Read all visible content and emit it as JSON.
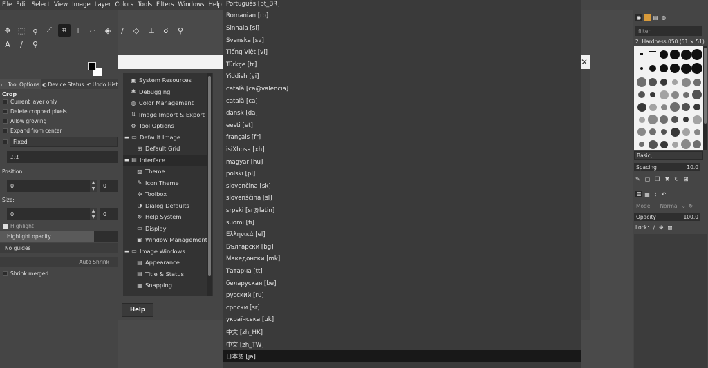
{
  "menu": [
    "File",
    "Edit",
    "Select",
    "View",
    "Image",
    "Layer",
    "Colors",
    "Tools",
    "Filters",
    "Windows",
    "Help"
  ],
  "left_tabs": {
    "tool_options": "Tool Options",
    "device_status": "Device Status",
    "undo_history": "Undo History"
  },
  "crop": {
    "title": "Crop",
    "current_layer_only": "Current layer only",
    "delete_cropped_pixels": "Delete cropped pixels",
    "allow_growing": "Allow growing",
    "expand_from_center": "Expand from center",
    "fixed_label": "Fixed",
    "ratio": "1:1",
    "position_label": "Position:",
    "position_x": "0",
    "position_y": "0",
    "size_label": "Size:",
    "size_w": "0",
    "size_h": "0",
    "highlight": "Highlight",
    "highlight_opacity": "Highlight opacity",
    "guides": "No guides",
    "auto_shrink": "Auto Shrink",
    "shrink_merged": "Shrink merged"
  },
  "prefs_tree": [
    {
      "label": "System Resources",
      "indent": 1,
      "icon": "chip"
    },
    {
      "label": "Debugging",
      "indent": 1,
      "icon": "bug"
    },
    {
      "label": "Color Management",
      "indent": 1,
      "icon": "color"
    },
    {
      "label": "Image Import & Export",
      "indent": 1,
      "icon": "import"
    },
    {
      "label": "Tool Options",
      "indent": 1,
      "icon": "tool"
    },
    {
      "label": "Default Image",
      "indent": 0,
      "icon": "image",
      "expanded": true
    },
    {
      "label": "Default Grid",
      "indent": 2,
      "icon": "grid"
    },
    {
      "label": "Interface",
      "indent": 0,
      "icon": "iface",
      "expanded": true,
      "selected": true
    },
    {
      "label": "Theme",
      "indent": 2,
      "icon": "theme"
    },
    {
      "label": "Icon Theme",
      "indent": 2,
      "icon": "icontheme"
    },
    {
      "label": "Toolbox",
      "indent": 2,
      "icon": "toolbox"
    },
    {
      "label": "Dialog Defaults",
      "indent": 2,
      "icon": "dialog"
    },
    {
      "label": "Help System",
      "indent": 2,
      "icon": "help"
    },
    {
      "label": "Display",
      "indent": 2,
      "icon": "display"
    },
    {
      "label": "Window Management",
      "indent": 2,
      "icon": "window"
    },
    {
      "label": "Image Windows",
      "indent": 0,
      "icon": "imgwin",
      "expanded": true
    },
    {
      "label": "Appearance",
      "indent": 2,
      "icon": "appearance"
    },
    {
      "label": "Title & Status",
      "indent": 2,
      "icon": "title"
    },
    {
      "label": "Snapping",
      "indent": 2,
      "icon": "snap"
    }
  ],
  "help_button": "Help",
  "languages": [
    "Português [pt_BR]",
    "Romanian [ro]",
    "Sinhala [si]",
    "Svenska [sv]",
    "Tiếng Việt [vi]",
    "Türkçe [tr]",
    "Yiddish [yi]",
    "català [ca@valencia]",
    "català [ca]",
    "dansk [da]",
    "eesti [et]",
    "français [fr]",
    "isiXhosa [xh]",
    "magyar [hu]",
    "polski [pl]",
    "slovenčina [sk]",
    "slovenščina [sl]",
    "srpski [sr@latin]",
    "suomi [fi]",
    "Ελληνικά [el]",
    "Български [bg]",
    "Македонски [mk]",
    "Татарча [tt]",
    "беларуская [be]",
    "русский [ru]",
    "српски [sr]",
    "українська [uk]",
    "中文 [zh_HK]",
    "中文 [zh_TW]",
    "日本語 [ja]"
  ],
  "selected_language": "日本語 [ja]",
  "brushes": {
    "filter_placeholder": "filter",
    "current": "2. Hardness 050 (51 × 51)",
    "set": "Basic,",
    "spacing_label": "Spacing",
    "spacing_value": "10.0"
  },
  "layers": {
    "mode_label": "Mode",
    "mode_value": "Normal",
    "opacity_label": "Opacity",
    "opacity_value": "100.0",
    "lock_label": "Lock:"
  }
}
